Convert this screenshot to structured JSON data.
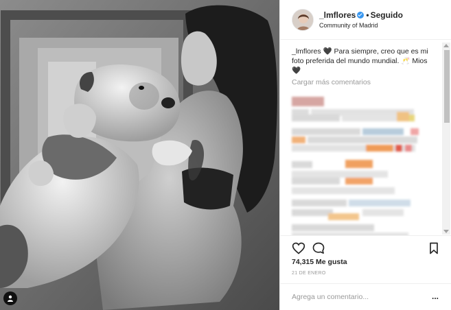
{
  "post": {
    "username": "_lmflores",
    "follow_state": "Seguido",
    "separator": "•",
    "location": "Community of Madrid",
    "caption_username": "_lmflores",
    "caption_text": "🖤 Para siempre, creo que es mi foto preferida del mundo mundial. 🥂 Mios🖤",
    "load_more": "Cargar más comentarios",
    "likes": "74,315 Me gusta",
    "date": "21 DE ENERO",
    "comment_placeholder": "Agrega un comentario...",
    "more_options": "..."
  },
  "blurred_comments": [
    {
      "colors": [
        "#c98a84",
        "#e6c5c2"
      ]
    },
    {
      "colors": [
        "#b9c7d6",
        "#e7d47e",
        "#f0b26a"
      ]
    },
    {
      "colors": [
        "#b7c8d8",
        "#c9c9c9",
        "#f1a3a6"
      ]
    },
    {
      "colors": [
        "#f1b27a",
        "#c9c9c9",
        "#ef6b4e",
        "#e88a8a"
      ]
    },
    {
      "colors": [
        "#c9c9c9",
        "#ef9b58"
      ]
    },
    {
      "colors": [
        "#c9c9c9",
        "#f2a367"
      ]
    },
    {
      "colors": [
        "#c9c9c9",
        "#b9d2e3"
      ]
    },
    {
      "colors": [
        "#c9c9c9",
        "#f3c68d"
      ]
    },
    {
      "colors": [
        "#c9c9c9"
      ]
    }
  ],
  "icons": {
    "like": "heart-icon",
    "comment": "comment-icon",
    "save": "bookmark-icon",
    "verified": "verified-badge-icon",
    "user_tag": "user-tag-icon"
  },
  "colors": {
    "verified": "#3897f0",
    "muted_text": "#999999",
    "border": "#efefef"
  }
}
